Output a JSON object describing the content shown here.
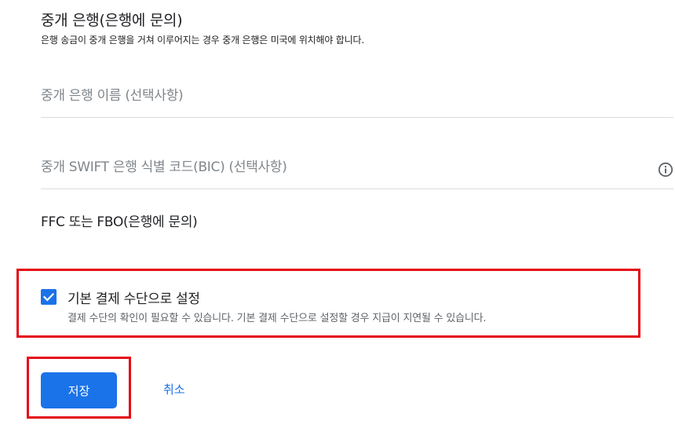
{
  "intermediary_bank": {
    "title": "중개 은행(은행에 문의)",
    "description": "은행 송금이 중개 은행을 거쳐 이루어지는 경우 중개 은행은 미국에 위치해야 합니다.",
    "bank_name_placeholder": "중개 은행 이름 (선택사항)",
    "swift_placeholder": "중개 SWIFT 은행 식별 코드(BIC) (선택사항)",
    "info_icon": "info-circle-icon"
  },
  "ffc_fbo": {
    "label": "FFC 또는 FBO(은행에 문의)"
  },
  "default_payment": {
    "checked": true,
    "label": "기본 결제 수단으로 설정",
    "description": "결제 수단의 확인이 필요할 수 있습니다. 기본 결제 수단으로 설정할 경우 지급이 지연될 수 있습니다."
  },
  "actions": {
    "save_label": "저장",
    "cancel_label": "취소"
  },
  "colors": {
    "accent": "#1a73e8",
    "highlight": "#e50914",
    "divider": "#dadce0",
    "placeholder": "#80868b"
  }
}
